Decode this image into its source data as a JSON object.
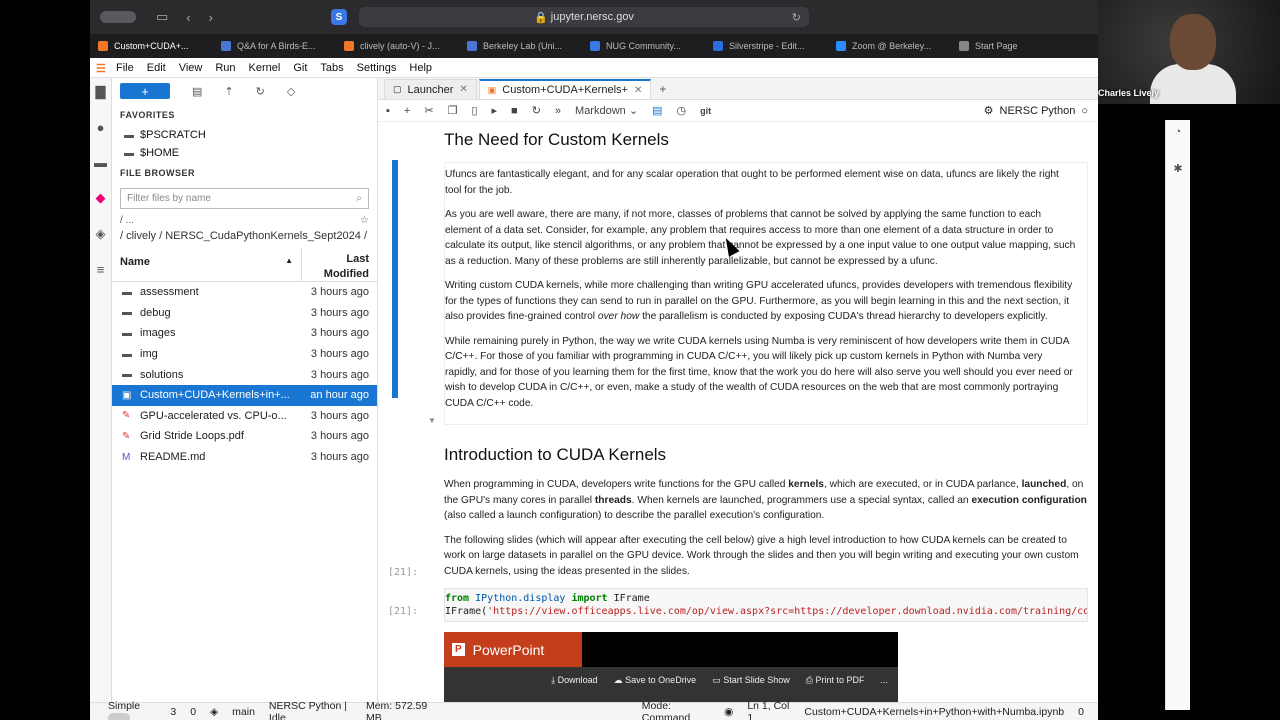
{
  "browser": {
    "url": "jupyter.nersc.gov",
    "tabs": [
      {
        "label": "Custom+CUDA+...",
        "color": "#f37726"
      },
      {
        "label": "Q&A for A Birds-E...",
        "color": "#4a77d4"
      },
      {
        "label": "clively (auto-V) - J...",
        "color": "#f37726"
      },
      {
        "label": "Berkeley Lab (Uni...",
        "color": "#4a77d4"
      },
      {
        "label": "NUG Community...",
        "color": "#3b78e7"
      },
      {
        "label": "Silverstripe - Edit...",
        "color": "#2d6cdf"
      },
      {
        "label": "Zoom @ Berkeley...",
        "color": "#2d8cff"
      },
      {
        "label": "Start Page",
        "color": "#888888"
      }
    ]
  },
  "menubar": [
    "File",
    "Edit",
    "View",
    "Run",
    "Kernel",
    "Git",
    "Tabs",
    "Settings",
    "Help"
  ],
  "filebrowser": {
    "new_label": "+",
    "favorites_title": "FAVORITES",
    "favorites": [
      "$PSCRATCH",
      "$HOME"
    ],
    "section_title": "FILE BROWSER",
    "filter_placeholder": "Filter files by name",
    "crumb_root": "/ ...",
    "path": "/ clively / NERSC_CudaPythonKernels_Sept2024 /",
    "col_name": "Name",
    "col_modified_1": "Last",
    "col_modified_2": "Modified",
    "files": [
      {
        "name": "assessment",
        "modified": "3 hours ago",
        "icon": "folder-icon"
      },
      {
        "name": "debug",
        "modified": "3 hours ago",
        "icon": "folder-icon"
      },
      {
        "name": "images",
        "modified": "3 hours ago",
        "icon": "folder-icon"
      },
      {
        "name": "img",
        "modified": "3 hours ago",
        "icon": "folder-icon"
      },
      {
        "name": "solutions",
        "modified": "3 hours ago",
        "icon": "folder-icon"
      },
      {
        "name": "Custom+CUDA+Kernels+in+...",
        "modified": "an hour ago",
        "icon": "notebook-icon"
      },
      {
        "name": "GPU-accelerated vs. CPU-o...",
        "modified": "3 hours ago",
        "icon": "pdf-icon"
      },
      {
        "name": "Grid Stride Loops.pdf",
        "modified": "3 hours ago",
        "icon": "pdf-icon"
      },
      {
        "name": "README.md",
        "modified": "3 hours ago",
        "icon": "markdown-icon"
      }
    ]
  },
  "doc_tabs": [
    "Launcher",
    "Custom+CUDA+Kernels+"
  ],
  "notebook_toolbar": {
    "cell_type": "Markdown",
    "git": "git",
    "kernel": "NERSC Python"
  },
  "notebook": {
    "h1": "The Need for Custom Kernels",
    "p1": "Ufuncs are fantastically elegant, and for any scalar operation that ought to be performed element wise on data, ufuncs are likely the right tool for the job.",
    "p2": "As you are well aware, there are many, if not more, classes of problems that cannot be solved by applying the same function to each element of a data set. Consider, for example, any problem that requires access to more than one element of a data structure in order to calculate its output, like stencil algorithms, or any problem that cannot be expressed by a one input value to one output value mapping, such as a reduction. Many of these problems are still inherently parallelizable, but cannot be expressed by a ufunc.",
    "p3a": "Writing custom CUDA kernels, while more challenging than writing GPU accelerated ufuncs, provides developers with tremendous flexibility for the types of functions they can send to run in parallel on the GPU. Furthermore, as you will begin learning in this and the next section, it also provides fine-grained control ",
    "p3em": "over how",
    "p3b": " the parallelism is conducted by exposing CUDA's thread hierarchy to developers explicitly.",
    "p4": "While remaining purely in Python, the way we write CUDA kernels using Numba is very reminiscent of how developers write them in CUDA C/C++. For those of you familiar with programming in CUDA C/C++, you will likely pick up custom kernels in Python with Numba very rapidly, and for those of you learning them for the first time, know that the work you do here will also serve you well should you ever need or wish to develop CUDA in C/C++, or even, make a study of the wealth of CUDA resources on the web that are most commonly portraying CUDA C/C++ code.",
    "h2": "Introduction to CUDA Kernels",
    "p5a": "When programming in CUDA, developers write functions for the GPU called ",
    "p5b": "kernels",
    "p5c": ", which are executed, or in CUDA parlance, ",
    "p5d": "launched",
    "p5e": ", on the GPU's many cores in parallel ",
    "p5f": "threads",
    "p5g": ". When kernels are launched, programmers use a special syntax, called an ",
    "p5h": "execution configuration",
    "p5i": " (also called a launch configuration) to describe the parallel execution's configuration.",
    "p6": "The following slides (which will appear after executing the cell below) give a high level introduction to how CUDA kernels can be created to work on large datasets in parallel on the GPU device. Work through the slides and then you will begin writing and executing your own custom CUDA kernels, using the ideas presented in the slides.",
    "prompt_in": "[21]:",
    "prompt_out": "[21]:",
    "code_l1_kw1": "from",
    "code_l1_mod": " IPython.display ",
    "code_l1_kw2": "import",
    "code_l1_rest": " IFrame",
    "code_l2_fn": "IFrame(",
    "code_l2_str": "'https://view.officeapps.live.com/op/view.aspx?src=https://developer.download.nvidia.com/training/cours"
  },
  "ppt": {
    "brand": "PowerPoint",
    "download": "Download",
    "onedrive": "Save to OneDrive",
    "slideshow": "Start Slide Show",
    "print": "Print to PDF",
    "more": "..."
  },
  "status": {
    "mode_label": "Simple",
    "n1": "3",
    "n2": "0",
    "branch": "main",
    "kernel": "NERSC Python | Idle",
    "mem": "Mem: 572.59 MB",
    "mode": "Mode: Command",
    "pos": "Ln 1, Col 1",
    "file": "Custom+CUDA+Kernels+in+Python+with+Numba.ipynb",
    "n3": "0"
  },
  "video": {
    "name": "Charles Lively"
  }
}
